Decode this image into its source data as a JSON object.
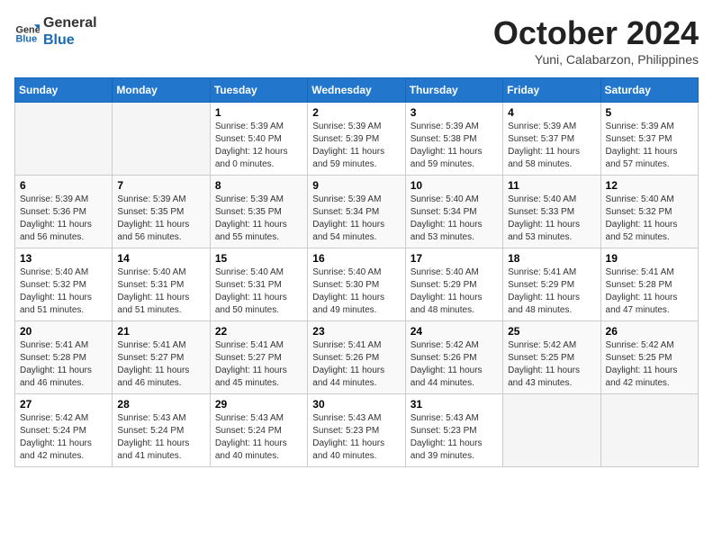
{
  "logo": {
    "line1": "General",
    "line2": "Blue"
  },
  "title": "October 2024",
  "subtitle": "Yuni, Calabarzon, Philippines",
  "weekdays": [
    "Sunday",
    "Monday",
    "Tuesday",
    "Wednesday",
    "Thursday",
    "Friday",
    "Saturday"
  ],
  "weeks": [
    [
      {
        "day": "",
        "info": ""
      },
      {
        "day": "",
        "info": ""
      },
      {
        "day": "1",
        "info": "Sunrise: 5:39 AM\nSunset: 5:40 PM\nDaylight: 12 hours\nand 0 minutes."
      },
      {
        "day": "2",
        "info": "Sunrise: 5:39 AM\nSunset: 5:39 PM\nDaylight: 11 hours\nand 59 minutes."
      },
      {
        "day": "3",
        "info": "Sunrise: 5:39 AM\nSunset: 5:38 PM\nDaylight: 11 hours\nand 59 minutes."
      },
      {
        "day": "4",
        "info": "Sunrise: 5:39 AM\nSunset: 5:37 PM\nDaylight: 11 hours\nand 58 minutes."
      },
      {
        "day": "5",
        "info": "Sunrise: 5:39 AM\nSunset: 5:37 PM\nDaylight: 11 hours\nand 57 minutes."
      }
    ],
    [
      {
        "day": "6",
        "info": "Sunrise: 5:39 AM\nSunset: 5:36 PM\nDaylight: 11 hours\nand 56 minutes."
      },
      {
        "day": "7",
        "info": "Sunrise: 5:39 AM\nSunset: 5:35 PM\nDaylight: 11 hours\nand 56 minutes."
      },
      {
        "day": "8",
        "info": "Sunrise: 5:39 AM\nSunset: 5:35 PM\nDaylight: 11 hours\nand 55 minutes."
      },
      {
        "day": "9",
        "info": "Sunrise: 5:39 AM\nSunset: 5:34 PM\nDaylight: 11 hours\nand 54 minutes."
      },
      {
        "day": "10",
        "info": "Sunrise: 5:40 AM\nSunset: 5:34 PM\nDaylight: 11 hours\nand 53 minutes."
      },
      {
        "day": "11",
        "info": "Sunrise: 5:40 AM\nSunset: 5:33 PM\nDaylight: 11 hours\nand 53 minutes."
      },
      {
        "day": "12",
        "info": "Sunrise: 5:40 AM\nSunset: 5:32 PM\nDaylight: 11 hours\nand 52 minutes."
      }
    ],
    [
      {
        "day": "13",
        "info": "Sunrise: 5:40 AM\nSunset: 5:32 PM\nDaylight: 11 hours\nand 51 minutes."
      },
      {
        "day": "14",
        "info": "Sunrise: 5:40 AM\nSunset: 5:31 PM\nDaylight: 11 hours\nand 51 minutes."
      },
      {
        "day": "15",
        "info": "Sunrise: 5:40 AM\nSunset: 5:31 PM\nDaylight: 11 hours\nand 50 minutes."
      },
      {
        "day": "16",
        "info": "Sunrise: 5:40 AM\nSunset: 5:30 PM\nDaylight: 11 hours\nand 49 minutes."
      },
      {
        "day": "17",
        "info": "Sunrise: 5:40 AM\nSunset: 5:29 PM\nDaylight: 11 hours\nand 48 minutes."
      },
      {
        "day": "18",
        "info": "Sunrise: 5:41 AM\nSunset: 5:29 PM\nDaylight: 11 hours\nand 48 minutes."
      },
      {
        "day": "19",
        "info": "Sunrise: 5:41 AM\nSunset: 5:28 PM\nDaylight: 11 hours\nand 47 minutes."
      }
    ],
    [
      {
        "day": "20",
        "info": "Sunrise: 5:41 AM\nSunset: 5:28 PM\nDaylight: 11 hours\nand 46 minutes."
      },
      {
        "day": "21",
        "info": "Sunrise: 5:41 AM\nSunset: 5:27 PM\nDaylight: 11 hours\nand 46 minutes."
      },
      {
        "day": "22",
        "info": "Sunrise: 5:41 AM\nSunset: 5:27 PM\nDaylight: 11 hours\nand 45 minutes."
      },
      {
        "day": "23",
        "info": "Sunrise: 5:41 AM\nSunset: 5:26 PM\nDaylight: 11 hours\nand 44 minutes."
      },
      {
        "day": "24",
        "info": "Sunrise: 5:42 AM\nSunset: 5:26 PM\nDaylight: 11 hours\nand 44 minutes."
      },
      {
        "day": "25",
        "info": "Sunrise: 5:42 AM\nSunset: 5:25 PM\nDaylight: 11 hours\nand 43 minutes."
      },
      {
        "day": "26",
        "info": "Sunrise: 5:42 AM\nSunset: 5:25 PM\nDaylight: 11 hours\nand 42 minutes."
      }
    ],
    [
      {
        "day": "27",
        "info": "Sunrise: 5:42 AM\nSunset: 5:24 PM\nDaylight: 11 hours\nand 42 minutes."
      },
      {
        "day": "28",
        "info": "Sunrise: 5:43 AM\nSunset: 5:24 PM\nDaylight: 11 hours\nand 41 minutes."
      },
      {
        "day": "29",
        "info": "Sunrise: 5:43 AM\nSunset: 5:24 PM\nDaylight: 11 hours\nand 40 minutes."
      },
      {
        "day": "30",
        "info": "Sunrise: 5:43 AM\nSunset: 5:23 PM\nDaylight: 11 hours\nand 40 minutes."
      },
      {
        "day": "31",
        "info": "Sunrise: 5:43 AM\nSunset: 5:23 PM\nDaylight: 11 hours\nand 39 minutes."
      },
      {
        "day": "",
        "info": ""
      },
      {
        "day": "",
        "info": ""
      }
    ]
  ]
}
